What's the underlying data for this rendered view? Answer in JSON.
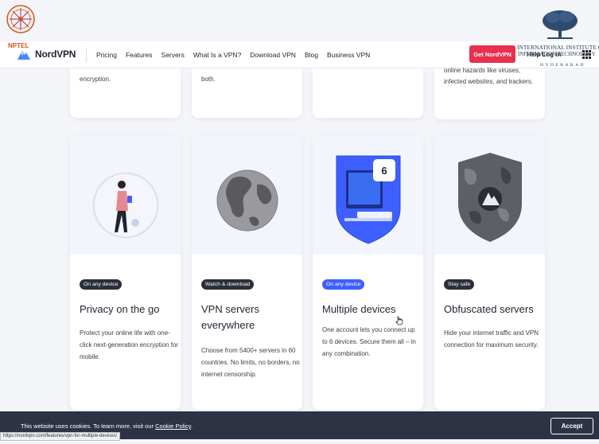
{
  "nav": {
    "brand": "NordVPN",
    "links": [
      "Pricing",
      "Features",
      "Servers",
      "What Is a VPN?",
      "Download VPN",
      "Blog",
      "Business VPN"
    ],
    "cta": "Get NordVPN",
    "help": "Help",
    "login": "Log in"
  },
  "overlay": {
    "nptel": "NPTEL",
    "iiit_title": "INTERNATIONAL INSTITUTE OF",
    "iiit_sub": "INFORMATION TECHNOLOGY",
    "iiit_city": "HYDERABAD"
  },
  "top_cards": [
    "encryption.",
    "both.",
    "",
    "online hazards like viruses, infected websites, and trackers."
  ],
  "cards": [
    {
      "badge": "On any device",
      "title": "Privacy on the go",
      "desc": "Protect your online life with one-click next-generation encryption for mobile."
    },
    {
      "badge": "Watch & download",
      "title": "VPN servers everywhere",
      "desc": "Choose from 5400+ servers in 60 countries. No limits, no borders, no internet censorship."
    },
    {
      "badge": "On any device",
      "title": "Multiple devices",
      "desc": "One account lets you connect up to 6 devices. Secure them all – in any combination.",
      "device_count": "6"
    },
    {
      "badge": "Stay safe",
      "title": "Obfuscated servers",
      "desc": "Hide your internet traffic and VPN connection for maximum security."
    }
  ],
  "cookie": {
    "text": "This website uses cookies. To learn more, visit our",
    "link": "Cookie Policy",
    "suffix": ".",
    "accept": "Accept"
  },
  "status_url": "https://nordvpn.com/features/vpn-for-multiple-devices/",
  "colors": {
    "accent_red": "#e8304d",
    "badge_blue": "#3e5fff",
    "badge_dark": "#2a2f3a",
    "cookie_bg": "#2d3345"
  }
}
